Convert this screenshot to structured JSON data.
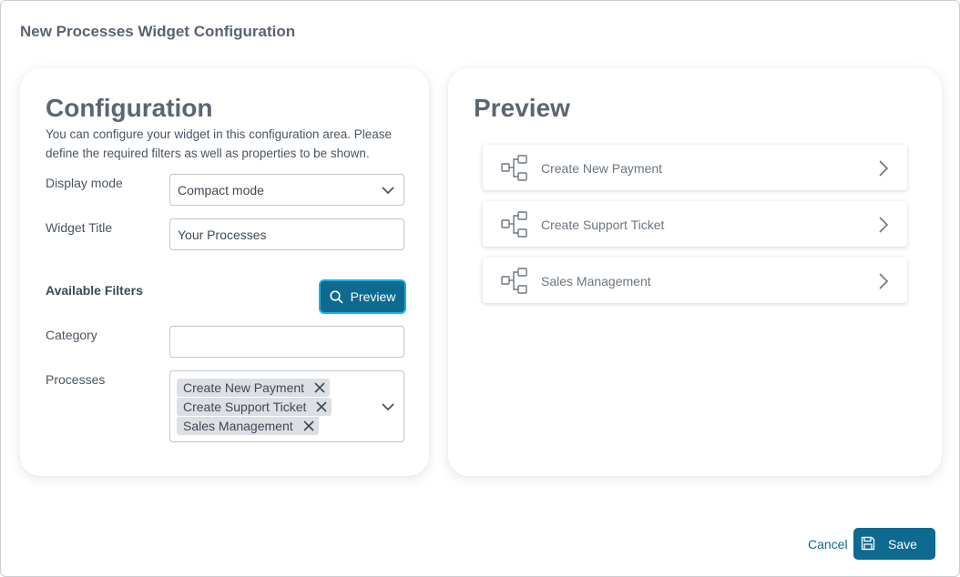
{
  "dialog": {
    "title": "New Processes Widget Configuration"
  },
  "config": {
    "heading": "Configuration",
    "description": "You can configure your widget in this configuration area. Please define the required filters as well as properties to be shown.",
    "display_mode_label": "Display mode",
    "display_mode_value": "Compact mode",
    "widget_title_label": "Widget Title",
    "widget_title_value": "Your Processes",
    "filters_title": "Available Filters",
    "preview_button": "Preview",
    "category_label": "Category",
    "category_value": "",
    "processes_label": "Processes",
    "processes_selected": [
      "Create New Payment",
      "Create Support Ticket",
      "Sales Management"
    ]
  },
  "preview": {
    "heading": "Preview",
    "items": [
      "Create New Payment",
      "Create Support Ticket",
      "Sales Management"
    ]
  },
  "footer": {
    "cancel": "Cancel",
    "save": "Save"
  },
  "colors": {
    "primary": "#0e6a8e",
    "focus_ring": "#1ab2e6",
    "chip_bg": "#dcdfe3"
  },
  "icons": {
    "dropdown": "chevron-down-icon",
    "preview": "search-icon",
    "chip_remove": "close-icon",
    "process": "process-flow-icon",
    "item_open": "chevron-right-icon",
    "save": "floppy-disk-icon"
  }
}
